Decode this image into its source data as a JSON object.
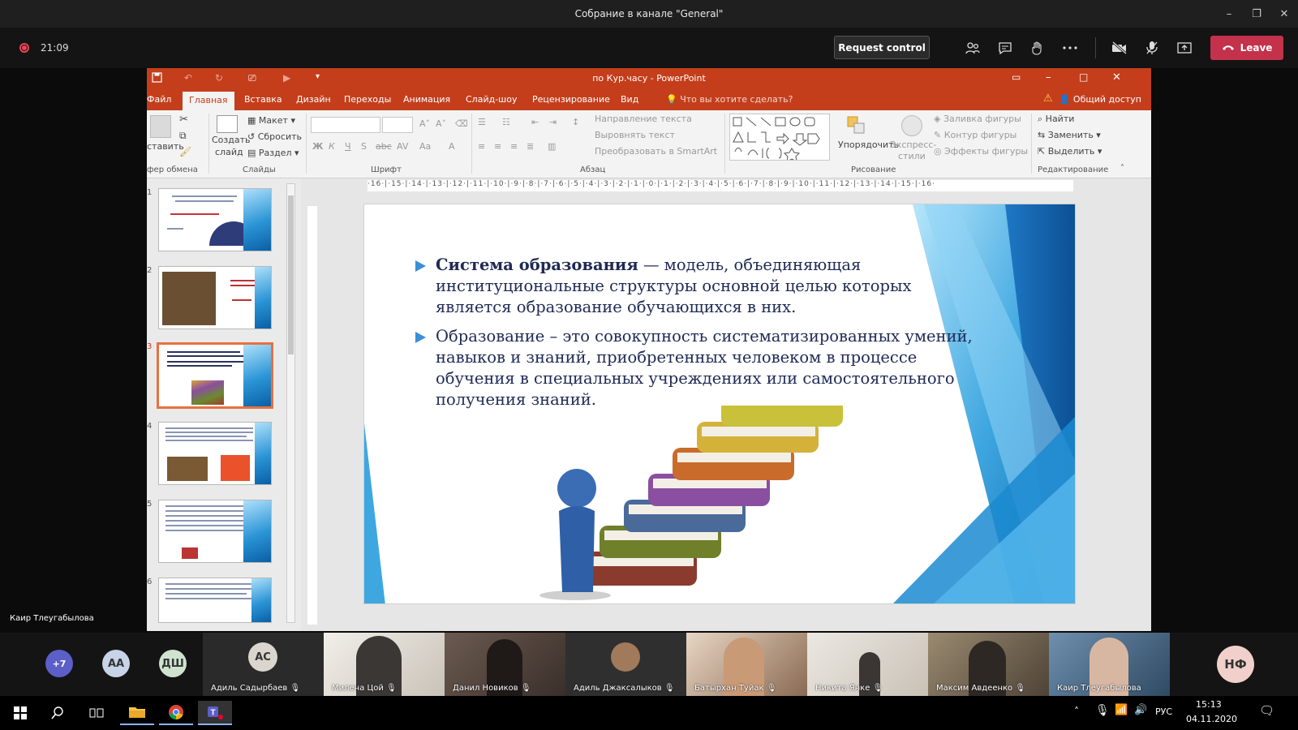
{
  "window": {
    "title": "Собрание в канале \"General\"",
    "min": "–",
    "restore": "❐",
    "close": "✕"
  },
  "meeting": {
    "timer": "21:09",
    "request_control": "Request control",
    "leave": "Leave",
    "leave_color": "#c4314b",
    "icons": [
      "participants-icon",
      "chat-icon",
      "raise-hand-icon",
      "more-icon",
      "camera-off-icon",
      "mic-icon",
      "share-icon"
    ]
  },
  "ppt": {
    "doc_title": "по Кур.часу - PowerPoint",
    "accent": "#c43e1c",
    "tabs": [
      "Файл",
      "Главная",
      "Вставка",
      "Дизайн",
      "Переходы",
      "Анимация",
      "Слайд-шоу",
      "Рецензирование",
      "Вид"
    ],
    "tell_me": "Что вы хотите сделать?",
    "share": "Общий доступ",
    "ribbon": {
      "paste": "ставить",
      "create_slide_1": "Создать",
      "create_slide_2": "слайд",
      "layout": "Макет",
      "reset": "Сбросить",
      "section": "Раздел",
      "text_direction": "Направление текста",
      "align_text": "Выровнять текст",
      "convert_smartart": "Преобразовать в SmartArt",
      "arrange": "Упорядочить",
      "quick_styles_1": "Экспресс-",
      "quick_styles_2": "стили",
      "shape_fill": "Заливка фигуры",
      "shape_outline": "Контур фигуры",
      "shape_effects": "Эффекты фигуры",
      "find": "Найти",
      "replace": "Заменить",
      "select": "Выделить",
      "groups": {
        "clipboard": "фер обмена",
        "slides": "Слайды",
        "font": "Шрифт",
        "paragraph": "Абзац",
        "drawing": "Рисование",
        "editing": "Редактирование"
      }
    },
    "ruler": "·16·|·15·|·14·|·13·|·12·|·11·|·10·|·9·|·8·|·7·|·6·|·5·|·4·|·3·|·2·|·1·|·0·|·1·|·2·|·3·|·4·|·5·|·6·|·7·|·8·|·9·|·10·|·11·|·12·|·13·|·14·|·15·|·16·",
    "slide_numbers": [
      "1",
      "2",
      "3",
      "4",
      "5",
      "6"
    ],
    "selected_slide": 3,
    "slide": {
      "bullet1_bold": "Система образования",
      "bullet1_rest": " — модель, объединяющая институциональные структуры основной целью которых является образование обучающихся в них.",
      "bullet2": "Образование – это совокупность систематизированных умений, навыков и знаний, приобретенных человеком в процессе обучения в специальных учреждениях или самостоятельного получения знаний."
    }
  },
  "presenter_label": "Каир Тлеугабылова",
  "participants": {
    "overflow": "+7",
    "avatars": [
      {
        "initials": "АА",
        "color": "#c7d3e6"
      },
      {
        "initials": "ДШ",
        "color": "#cfe3cf"
      }
    ],
    "tiles": [
      {
        "name": "Адиль Садырбаев",
        "initials": "АС",
        "bg": "#2a2a2a"
      },
      {
        "name": "Милена Цой",
        "bg": "#e9e4dc"
      },
      {
        "name": "Данил Новиков",
        "bg": "#5a4a44"
      },
      {
        "name": "Адиль Джаксалыков",
        "bg": "#2f2f2f"
      },
      {
        "name": "Батырхан Туйак",
        "bg": "#b4876e"
      },
      {
        "name": "Никита Янке",
        "bg": "#d9d4cc"
      },
      {
        "name": "Максим Авдеенко",
        "bg": "#7a6c58"
      },
      {
        "name": "Каир Тлеугабылова",
        "bg": "#4e6f8d"
      }
    ],
    "extra_avatar": {
      "initials": "НФ",
      "color": "#f1d0cc"
    }
  },
  "taskbar": {
    "lang": "РУС",
    "time": "15:13",
    "date": "04.11.2020"
  }
}
